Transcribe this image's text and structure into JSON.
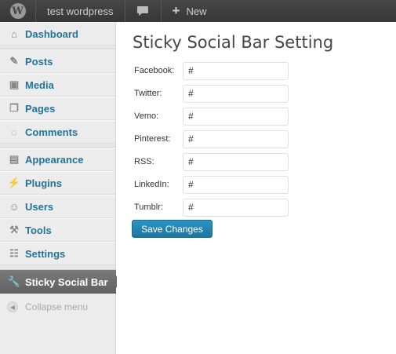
{
  "adminbar": {
    "site_name": "test wordpress",
    "new_label": "New"
  },
  "sidebar": {
    "items": [
      {
        "label": "Dashboard",
        "icon": "dashboard-icon"
      },
      {
        "label": "Posts",
        "icon": "pushpin-icon"
      },
      {
        "label": "Media",
        "icon": "media-icon"
      },
      {
        "label": "Pages",
        "icon": "pages-icon"
      },
      {
        "label": "Comments",
        "icon": "comment-icon"
      },
      {
        "label": "Appearance",
        "icon": "appearance-icon"
      },
      {
        "label": "Plugins",
        "icon": "plug-icon"
      },
      {
        "label": "Users",
        "icon": "users-icon"
      },
      {
        "label": "Tools",
        "icon": "tools-icon"
      },
      {
        "label": "Settings",
        "icon": "settings-icon"
      }
    ],
    "current": {
      "label": "Sticky Social Bar",
      "icon": "wrench-icon"
    },
    "collapse_label": "Collapse menu"
  },
  "main": {
    "title": "Sticky Social Bar Setting",
    "fields": [
      {
        "label": "Facebook:",
        "value": "#"
      },
      {
        "label": "Twitter:",
        "value": "#"
      },
      {
        "label": "Vemo:",
        "value": "#"
      },
      {
        "label": "Pinterest:",
        "value": "#"
      },
      {
        "label": "RSS:",
        "value": "#"
      },
      {
        "label": "LinkedIn:",
        "value": "#"
      },
      {
        "label": "Tumblr:",
        "value": "#"
      }
    ],
    "save_label": "Save Changes"
  },
  "colors": {
    "adminbar_bg": "#464646",
    "sidebar_bg": "#ececec",
    "link_blue": "#21759b",
    "current_menu_bg": "#6b6b6b",
    "button_blue": "#2a95c5"
  }
}
